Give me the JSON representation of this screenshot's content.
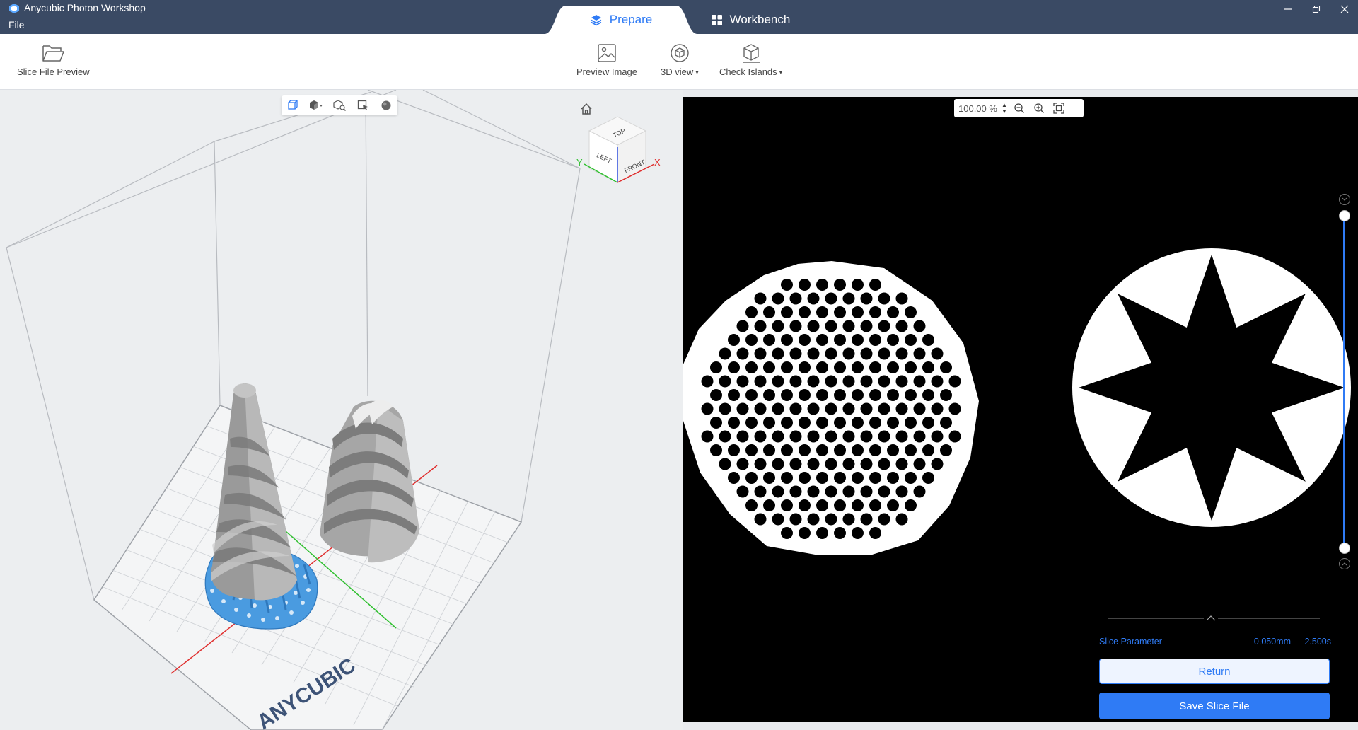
{
  "app": {
    "title": "Anycubic Photon Workshop",
    "menu_file": "File"
  },
  "tabs": [
    {
      "label": "Prepare",
      "active": true
    },
    {
      "label": "Workbench",
      "active": false
    }
  ],
  "toolbar": {
    "slice_file_preview": "Slice File Preview",
    "preview_image": "Preview Image",
    "view_3d": "3D view",
    "check_islands": "Check Islands"
  },
  "viewport": {
    "cube_top": "TOP",
    "cube_left": "LEFT",
    "cube_front": "FRONT",
    "axis_x": "X",
    "axis_y": "Y",
    "watermark_brand": "ANYCUBIC"
  },
  "slice_view": {
    "zoom": "100.00 %"
  },
  "slice_parameter": {
    "label": "Slice Parameter",
    "layer_height": "0.050mm",
    "separator": "—",
    "exposure": "2.500s"
  },
  "buttons": {
    "return": "Return",
    "save_slice_file": "Save Slice File"
  },
  "colors": {
    "accent": "#2f7bf5",
    "titlebar": "#3a4a64",
    "support": "#4a9be0"
  }
}
